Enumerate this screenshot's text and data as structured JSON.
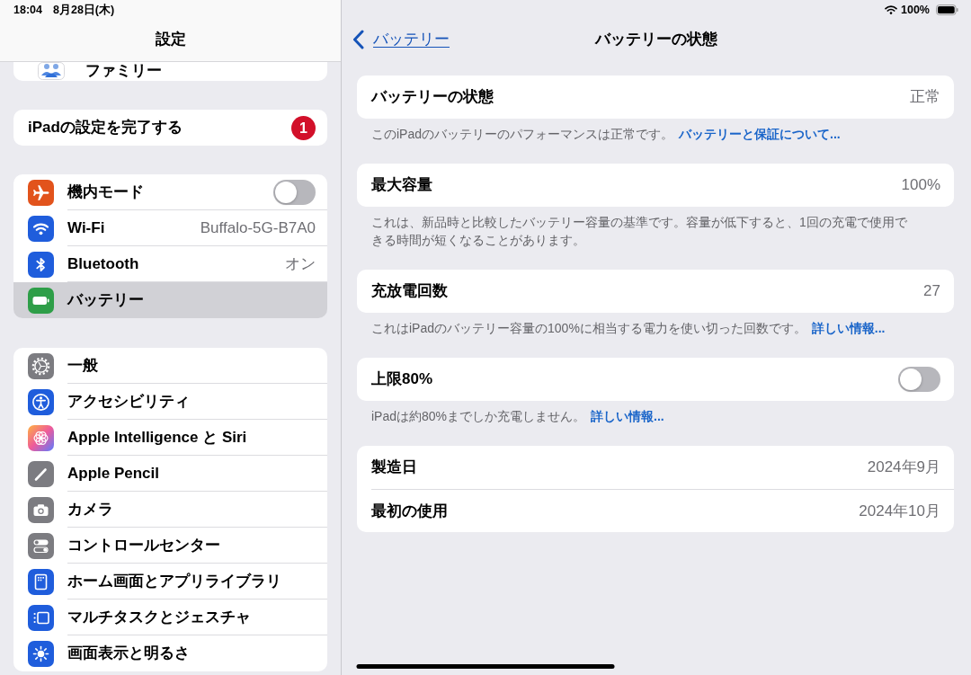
{
  "status_bar": {
    "time": "18:04",
    "date": "8月28日(木)",
    "battery": "100%"
  },
  "sidebar": {
    "title": "設定",
    "groups": [
      {
        "items": [
          {
            "label": "ファミリー",
            "kind": "link",
            "selected": false
          }
        ]
      },
      {
        "items": [
          {
            "label": "iPadの設定を完了する",
            "kind": "badge",
            "badge": "1",
            "selected": false
          }
        ]
      },
      {
        "items": [
          {
            "label": "機内モード",
            "kind": "toggle",
            "on": false,
            "selected": false
          },
          {
            "label": "Wi-Fi",
            "kind": "value",
            "value": "Buffalo-5G-B7A0",
            "selected": false
          },
          {
            "label": "Bluetooth",
            "kind": "value",
            "value": "オン",
            "selected": false
          },
          {
            "label": "バッテリー",
            "kind": "link",
            "selected": true
          }
        ]
      },
      {
        "items": [
          {
            "label": "一般",
            "kind": "link",
            "selected": false
          },
          {
            "label": "アクセシビリティ",
            "kind": "link",
            "selected": false
          },
          {
            "label": "Apple Intelligence と Siri",
            "kind": "link",
            "selected": false
          },
          {
            "label": "Apple Pencil",
            "kind": "link",
            "selected": false
          },
          {
            "label": "カメラ",
            "kind": "link",
            "selected": false
          },
          {
            "label": "コントロールセンター",
            "kind": "link",
            "selected": false
          },
          {
            "label": "ホーム画面とアプリライブラリ",
            "kind": "link",
            "selected": false
          },
          {
            "label": "マルチタスクとジェスチャ",
            "kind": "link",
            "selected": false
          },
          {
            "label": "画面表示と明るさ",
            "kind": "link",
            "selected": false
          }
        ]
      }
    ]
  },
  "detail": {
    "back_label": "バッテリー",
    "title": "バッテリーの状態",
    "sections": [
      {
        "rows": [
          {
            "label": "バッテリーの状態",
            "kind": "value",
            "value": "正常"
          }
        ],
        "footer": "このiPadのバッテリーのパフォーマンスは正常です。",
        "footer_link": "バッテリーと保証について..."
      },
      {
        "rows": [
          {
            "label": "最大容量",
            "kind": "value",
            "value": "100%"
          }
        ],
        "footer": "これは、新品時と比較したバッテリー容量の基準です。容量が低下すると、1回の充電で使用できる時間が短くなることがあります。"
      },
      {
        "rows": [
          {
            "label": "充放電回数",
            "kind": "value",
            "value": "27"
          }
        ],
        "footer": "これはiPadのバッテリー容量の100%に相当する電力を使い切った回数です。",
        "footer_link": "詳しい情報..."
      },
      {
        "rows": [
          {
            "label": "上限80%",
            "kind": "toggle",
            "on": false
          }
        ],
        "footer": "iPadは約80%までしか充電しません。",
        "footer_link": "詳しい情報..."
      },
      {
        "rows": [
          {
            "label": "製造日",
            "kind": "value",
            "value": "2024年9月"
          },
          {
            "label": "最初の使用",
            "kind": "value",
            "value": "2024年10月"
          }
        ]
      }
    ]
  }
}
